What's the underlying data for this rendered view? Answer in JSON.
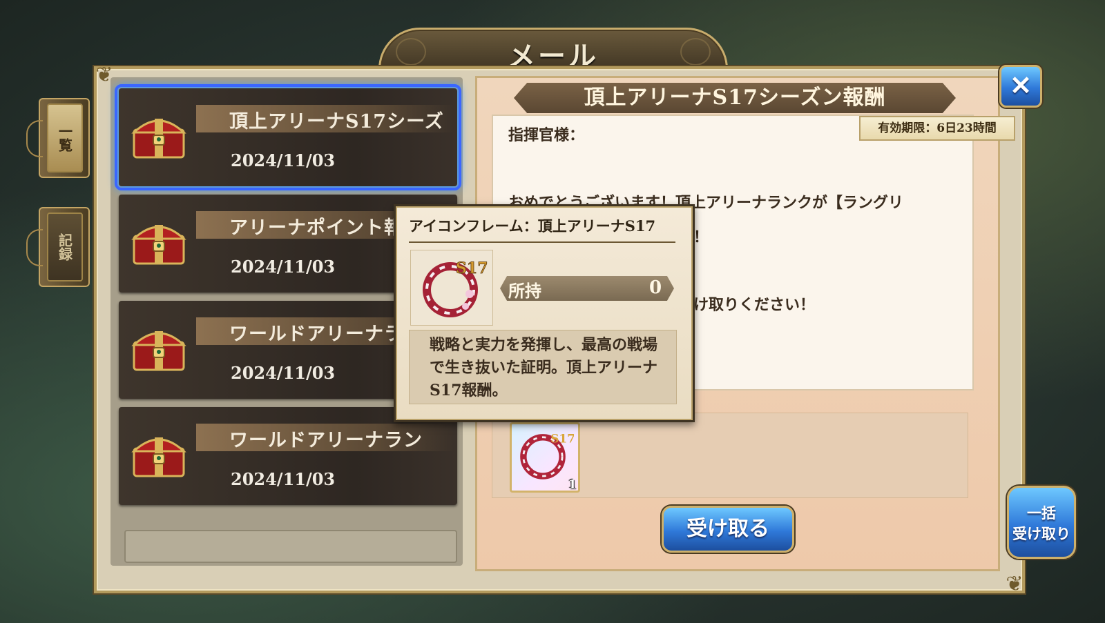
{
  "screen": {
    "title": "メール"
  },
  "side_tabs": [
    {
      "label": "一覧",
      "active": true
    },
    {
      "label": "記録",
      "active": false
    }
  ],
  "mail_list": [
    {
      "subject": "頂上アリーナS17シーズ",
      "date": "2024/11/03",
      "selected": true,
      "icon": "treasure-chest-icon"
    },
    {
      "subject": "アリーナポイント報",
      "date": "2024/11/03",
      "selected": false,
      "icon": "treasure-chest-icon"
    },
    {
      "subject": "ワールドアリーナラ",
      "date": "2024/11/03",
      "selected": false,
      "icon": "treasure-chest-icon"
    },
    {
      "subject": "ワールドアリーナラン",
      "date": "2024/11/03",
      "selected": false,
      "icon": "treasure-chest-icon"
    }
  ],
  "detail": {
    "title": "頂上アリーナS17シーズン報酬",
    "expiry": "有効期限：6日23時間",
    "greeting": "指揮官様：",
    "body_line1": "おめでとうございます！頂上アリーナランクが【ラングリ",
    "body_line2": "！",
    "body_line3": "け取りください！",
    "reward": {
      "icon": "icon-frame-s17-icon",
      "count": "1"
    },
    "receive_button": "受け取る"
  },
  "tooltip": {
    "title": "アイコンフレーム：頂上アリーナS17",
    "owned_label": "所持",
    "owned_value": "0",
    "description": "戦略と実力を発揮し、最高の戦場で生き抜いた証明。頂上アリーナS17報酬。"
  },
  "buttons": {
    "bulk_receive_line1": "一括",
    "bulk_receive_line2": "受け取り",
    "close": "✕"
  },
  "colors": {
    "selection_outline": "#3a66ff",
    "button_blue": "#2f79d9",
    "frame_gold": "#b39a5d"
  }
}
